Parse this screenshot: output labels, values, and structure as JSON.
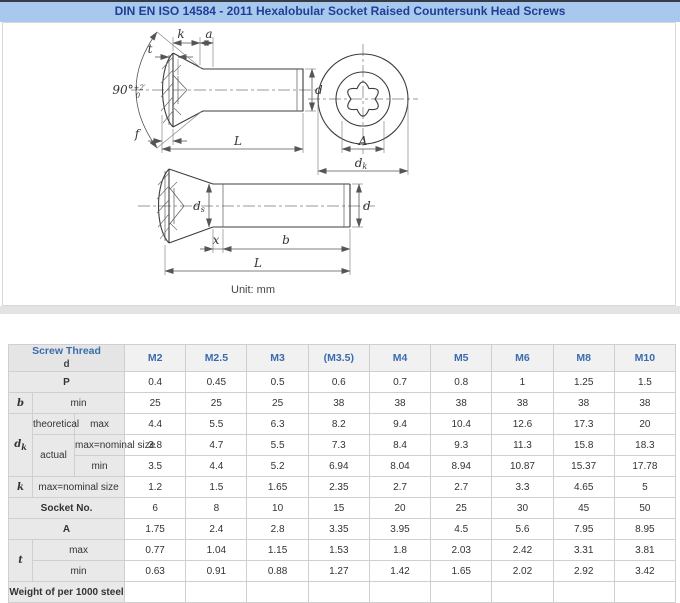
{
  "title": "DIN EN ISO 14584 - 2011 Hexalobular Socket Raised Countersunk Head Screws",
  "drawing": {
    "unit_label": "Unit: mm",
    "labels": {
      "k": "k",
      "a": "a",
      "t": "t",
      "f": "f",
      "L": "L",
      "d": "d",
      "A": "A",
      "x": "x",
      "b": "b",
      "angle": {
        "deg": "90°",
        "sup": "+2′",
        "sub": "0"
      },
      "dk": {
        "main": "d",
        "sub": "k"
      },
      "ds": {
        "main": "d",
        "sub": "s"
      }
    }
  },
  "table": {
    "corner": {
      "line1": "Screw Thread",
      "line2": "d"
    },
    "columns": [
      "M2",
      "M2.5",
      "M3",
      "(M3.5)",
      "M4",
      "M5",
      "M6",
      "M8",
      "M10"
    ],
    "rows": [
      {
        "label": "P",
        "values": [
          "0.4",
          "0.45",
          "0.5",
          "0.6",
          "0.7",
          "0.8",
          "1",
          "1.25",
          "1.5"
        ]
      },
      {
        "sym": "b",
        "label": "min",
        "values": [
          "25",
          "25",
          "25",
          "38",
          "38",
          "38",
          "38",
          "38",
          "38"
        ]
      },
      {
        "sym_main": "d",
        "sym_sub": "k",
        "group": "theoretical",
        "label": "max",
        "values": [
          "4.4",
          "5.5",
          "6.3",
          "8.2",
          "9.4",
          "10.4",
          "12.6",
          "17.3",
          "20"
        ]
      },
      {
        "group": "actual",
        "label": "max=nominal size",
        "values": [
          "3.8",
          "4.7",
          "5.5",
          "7.3",
          "8.4",
          "9.3",
          "11.3",
          "15.8",
          "18.3"
        ]
      },
      {
        "label": "min",
        "values": [
          "3.5",
          "4.4",
          "5.2",
          "6.94",
          "8.04",
          "8.94",
          "10.87",
          "15.37",
          "17.78"
        ]
      },
      {
        "sym": "k",
        "label": "max=nominal size",
        "values": [
          "1.2",
          "1.5",
          "1.65",
          "2.35",
          "2.7",
          "2.7",
          "3.3",
          "4.65",
          "5"
        ]
      },
      {
        "label": "Socket No.",
        "values": [
          "6",
          "8",
          "10",
          "15",
          "20",
          "25",
          "30",
          "45",
          "50"
        ]
      },
      {
        "label": "A",
        "values": [
          "1.75",
          "2.4",
          "2.8",
          "3.35",
          "3.95",
          "4.5",
          "5.6",
          "7.95",
          "8.95"
        ]
      },
      {
        "sym": "t",
        "label": "max",
        "values": [
          "0.77",
          "1.04",
          "1.15",
          "1.53",
          "1.8",
          "2.03",
          "2.42",
          "3.31",
          "3.81"
        ]
      },
      {
        "label": "min",
        "values": [
          "0.63",
          "0.91",
          "0.88",
          "1.27",
          "1.42",
          "1.65",
          "2.02",
          "2.92",
          "3.42"
        ]
      },
      {
        "label": "Weight of per 1000 steel"
      }
    ]
  },
  "colors": {
    "title_bg": "#a9c8ee",
    "title_text": "#1d3f94",
    "column_header_text": "#3a6cad",
    "table_label_bg": "#e9e9e9"
  }
}
